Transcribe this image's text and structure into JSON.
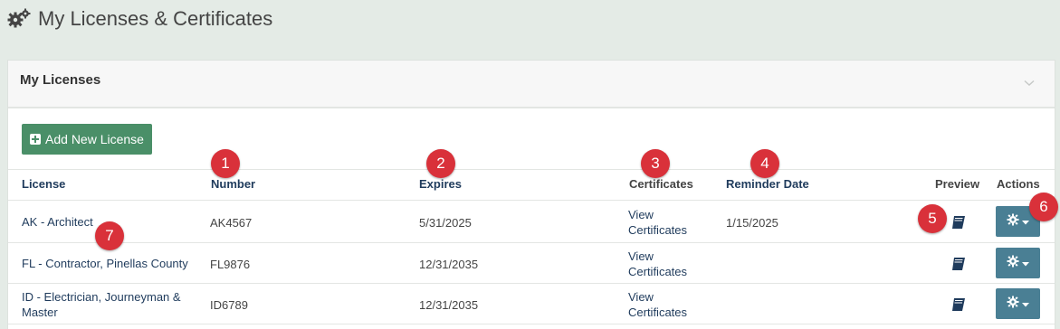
{
  "page": {
    "title": "My Licenses & Certificates",
    "title_icon": "gears-icon"
  },
  "panel": {
    "title": "My Licenses",
    "collapse_icon": "chevron-down-icon",
    "add_button_label": "Add New License"
  },
  "table": {
    "headers": [
      "License",
      "Number",
      "Expires",
      "Certificates",
      "Reminder Date",
      "Preview",
      "Actions"
    ],
    "rows": [
      {
        "license": "AK - Architect",
        "number": "AK4567",
        "expires": "5/31/2025",
        "certificates_line1": "View",
        "certificates_line2": "Certificates",
        "reminder": "1/15/2025"
      },
      {
        "license": "FL - Contractor, Pinellas County",
        "number": "FL9876",
        "expires": "12/31/2035",
        "certificates_line1": "View",
        "certificates_line2": "Certificates",
        "reminder": ""
      },
      {
        "license_line1": "ID - Electrician, Journeyman &",
        "license_line2": "Master",
        "number": "ID6789",
        "expires": "12/31/2035",
        "certificates_line1": "View",
        "certificates_line2": "Certificates",
        "reminder": ""
      }
    ]
  },
  "annotations": [
    "1",
    "2",
    "3",
    "4",
    "5",
    "6",
    "7"
  ],
  "colors": {
    "background": "#e4ebe6",
    "add_button": "#4a8f68",
    "action_button": "#4a7f94",
    "header_text": "#1f3b5c",
    "badge": "#d9313a"
  }
}
